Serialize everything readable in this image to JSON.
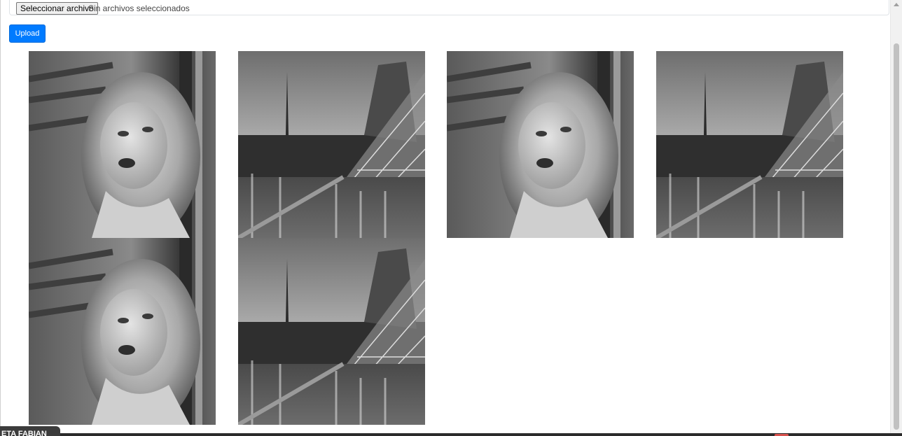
{
  "form": {
    "file_button_label": "Seleccionar archivo",
    "file_status": "Sin archivos seleccionados",
    "upload_label": "Upload"
  },
  "gallery": {
    "images": [
      {
        "subject": "portrait-woman-bw",
        "alt": ""
      },
      {
        "subject": "paris-louvre-eiffel-bw",
        "alt": ""
      },
      {
        "subject": "portrait-woman-bw",
        "alt": ""
      },
      {
        "subject": "paris-louvre-eiffel-bw",
        "alt": ""
      },
      {
        "subject": "portrait-woman-bw",
        "alt": ""
      },
      {
        "subject": "paris-louvre-eiffel-bw",
        "alt": ""
      }
    ]
  },
  "overlay": {
    "name_tag": "ETA FABIAN"
  },
  "colors": {
    "upload_button": "#007bff",
    "page_background": "#ffffff"
  }
}
